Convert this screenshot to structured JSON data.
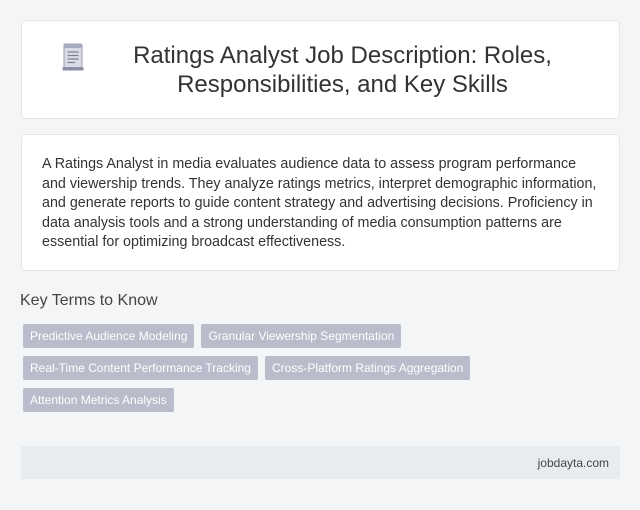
{
  "header": {
    "icon": "document-icon",
    "title": "Ratings Analyst Job Description: Roles, Responsibilities, and Key Skills"
  },
  "description": {
    "text": "A Ratings Analyst in media evaluates audience data to assess program performance and viewership trends. They analyze ratings metrics, interpret demographic information, and generate reports to guide content strategy and advertising decisions. Proficiency in data analysis tools and a strong understanding of media consumption patterns are essential for optimizing broadcast effectiveness."
  },
  "key_terms": {
    "heading": "Key Terms to Know",
    "tags": [
      "Predictive Audience Modeling",
      "Granular Viewership Segmentation",
      "Real-Time Content Performance Tracking",
      "Cross-Platform Ratings Aggregation",
      "Attention Metrics Analysis"
    ]
  },
  "footer": {
    "link_text": "jobdayta.com"
  },
  "colors": {
    "tag_background": "#b9bccb",
    "footer_background": "#e8ecef",
    "page_background": "#f4f5f7"
  }
}
